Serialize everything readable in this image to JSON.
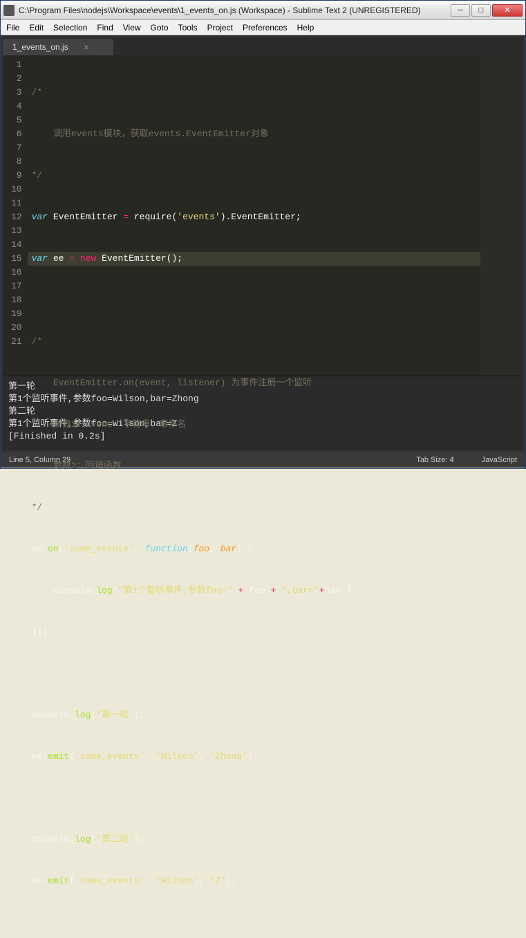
{
  "window": {
    "title": "C:\\Program Files\\nodejs\\Workspace\\events\\1_events_on.js (Workspace) - Sublime Text 2 (UNREGISTERED)"
  },
  "menu": [
    "File",
    "Edit",
    "Selection",
    "Find",
    "View",
    "Goto",
    "Tools",
    "Project",
    "Preferences",
    "Help"
  ],
  "tab": {
    "label": "1_events_on.js",
    "close": "×"
  },
  "gutter": [
    "1",
    "2",
    "3",
    "4",
    "5",
    "6",
    "7",
    "8",
    "9",
    "10",
    "11",
    "12",
    "13",
    "14",
    "15",
    "16",
    "17",
    "18",
    "19",
    "20",
    "21"
  ],
  "code": {
    "l1": "/*",
    "l2": "    调用events模块，获取events.EventEmitter对象",
    "l3": "*/",
    "l4": {
      "kw": "var",
      "var": " EventEmitter ",
      "op": "=",
      "rest": " require(",
      "str": "'events'",
      "rest2": ").EventEmitter;"
    },
    "l5": {
      "kw": "var",
      "var": " ee ",
      "op": "=",
      "new": " new",
      "ctor": " EventEmitter",
      "rest": "();"
    },
    "l6": "",
    "l7": "/*",
    "l8": "    EventEmitter.on(event, listener) 为事件注册一个监听",
    "l9": "    参数1：event  字符串，事件名",
    "l10": "    参数2：回调函数",
    "l11": "*/",
    "l12": {
      "pre": "ee.",
      "fn": "on",
      "open": "(",
      "str": "'some_events'",
      "mid": ", ",
      "kw": "function",
      "open2": "(",
      "p1": "foo",
      "c": ", ",
      "p2": "bar",
      "rest": ") {"
    },
    "l13": {
      "pre": "    console.",
      "fn": "log",
      "open": "(",
      "str": "\"第1个监听事件,参数foo=\"",
      "op": " + ",
      "v": "foo",
      "op2": " + ",
      "str2": "\",bar=\"",
      "op3": "+",
      "v2": "bar",
      "rest": " );"
    },
    "l14": "});",
    "l15": "",
    "l16": {
      "pre": "console.",
      "fn": "log",
      "open": "(",
      "str": "'第一轮'",
      "rest": ");"
    },
    "l17": {
      "pre": "ee.",
      "fn": "emit",
      "open": "(",
      "str": "'some_events'",
      "mid": ", ",
      "str2": "'Wilson'",
      "mid2": ", ",
      "str3": "'Zhong'",
      "rest": ");"
    },
    "l18": "",
    "l19": {
      "pre": "console.",
      "fn": "log",
      "open": "(",
      "str": "'第二轮'",
      "rest": ");"
    },
    "l20": {
      "pre": "ee.",
      "fn": "emit",
      "open": "(",
      "str": "'some_events'",
      "mid": ", ",
      "str2": "'Wilson'",
      "mid2": ", ",
      "str3": "'Z'",
      "rest": ");"
    },
    "l21": ""
  },
  "console": {
    "l1": "第一轮",
    "l2": "第1个监听事件,参数foo=Wilson,bar=Zhong",
    "l3": "第二轮",
    "l4": "第1个监听事件,参数foo=Wilson,bar=Z",
    "l5": "[Finished in 0.2s]"
  },
  "status": {
    "cursor": "Line 5, Column 29",
    "tabsize": "Tab Size: 4",
    "lang": "JavaScript"
  }
}
